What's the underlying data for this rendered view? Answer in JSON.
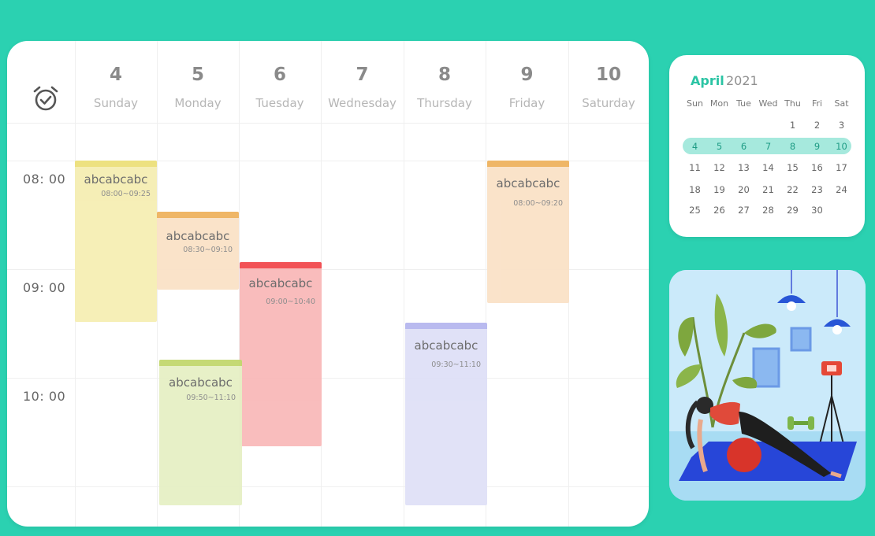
{
  "schedule": {
    "days": [
      {
        "num": "4",
        "name": "Sunday"
      },
      {
        "num": "5",
        "name": "Monday"
      },
      {
        "num": "6",
        "name": "Tuesday"
      },
      {
        "num": "7",
        "name": "Wednesday"
      },
      {
        "num": "8",
        "name": "Thursday"
      },
      {
        "num": "9",
        "name": "Friday"
      },
      {
        "num": "10",
        "name": "Saturday"
      }
    ],
    "times": [
      "08: 00",
      "09: 00",
      "10: 00"
    ],
    "events": [
      {
        "title": "abcabcabc",
        "time": "08:00~09:25",
        "color": "#f5eeb3",
        "accent": "#ede07a"
      },
      {
        "title": "abcabcabc",
        "time": "08:30~09:10",
        "color": "#fae2c7",
        "accent": "#efb35e"
      },
      {
        "title": "abcabcabc",
        "time": "09:00~10:40",
        "color": "#f9b9b9",
        "accent": "#f2494d"
      },
      {
        "title": "abcabcabc",
        "time": "09:50~11:10",
        "color": "#e6f0c5",
        "accent": "#c2d86e"
      },
      {
        "title": "abcabcabc",
        "time": "09:30~11:10",
        "color": "#dfe0f7",
        "accent": "#b6b7ef"
      },
      {
        "title": "abcabcabc",
        "time": "08:00~09:20",
        "color": "#fae2c7",
        "accent": "#efb35e"
      }
    ]
  },
  "minical": {
    "month": "April",
    "year": "2021",
    "weekdays": [
      "Sun",
      "Mon",
      "Tue",
      "Wed",
      "Thu",
      "Fri",
      "Sat"
    ],
    "weeks": [
      [
        "",
        "",
        "",
        "",
        "1",
        "2",
        "3"
      ],
      [
        "4",
        "5",
        "6",
        "7",
        "8",
        "9",
        "10"
      ],
      [
        "11",
        "12",
        "13",
        "14",
        "15",
        "16",
        "17"
      ],
      [
        "18",
        "19",
        "20",
        "21",
        "22",
        "23",
        "24"
      ],
      [
        "25",
        "26",
        "27",
        "28",
        "29",
        "30",
        ""
      ]
    ],
    "highlight_color": "#a6e9dd",
    "accent": "#2bc4a4"
  },
  "illustration": {
    "icon": "yoga-illustration"
  },
  "colors": {
    "background": "#2bd1b1"
  }
}
